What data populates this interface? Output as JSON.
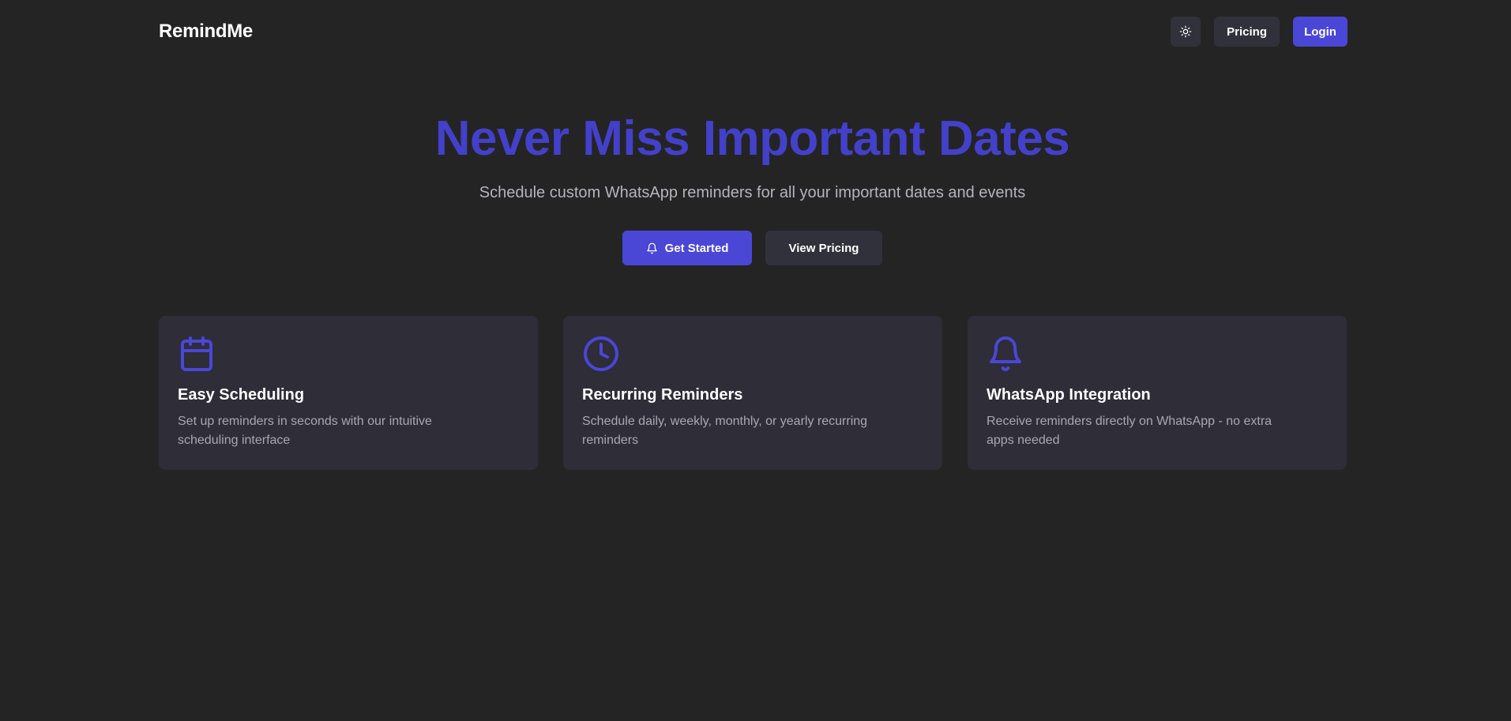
{
  "header": {
    "brand": "RemindMe",
    "theme_toggle_icon": "sun-icon",
    "pricing_label": "Pricing",
    "login_label": "Login"
  },
  "hero": {
    "title": "Never Miss Important Dates",
    "subtitle": "Schedule custom WhatsApp reminders for all your important dates and events",
    "get_started_label": "Get Started",
    "get_started_icon": "bell-icon",
    "view_pricing_label": "View Pricing"
  },
  "features": [
    {
      "icon": "calendar-icon",
      "title": "Easy Scheduling",
      "description": "Set up reminders in seconds with our intuitive scheduling interface"
    },
    {
      "icon": "clock-icon",
      "title": "Recurring Reminders",
      "description": "Schedule daily, weekly, monthly, or yearly recurring reminders"
    },
    {
      "icon": "bell-icon",
      "title": "WhatsApp Integration",
      "description": "Receive reminders directly on WhatsApp - no extra apps needed"
    }
  ],
  "colors": {
    "background": "#242424",
    "accent": "#4a47d6",
    "accent_text": "#4340c9",
    "card": "#2e2d38",
    "secondary_button": "#31313b"
  }
}
